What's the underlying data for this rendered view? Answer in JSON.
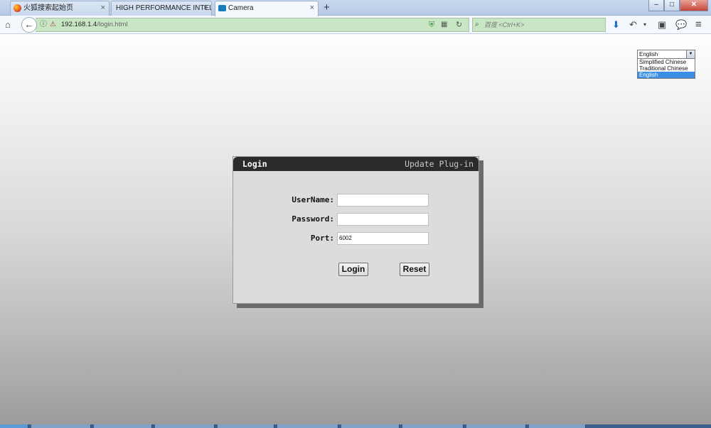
{
  "browser": {
    "tabs": [
      {
        "label": "火狐搜索起始页",
        "active": false,
        "icon": "firefox-icon"
      },
      {
        "label": "HIGH PERFORMANCE INTEL...",
        "active": false,
        "icon": ""
      },
      {
        "label": "Camera",
        "active": true,
        "icon": "camera-icon"
      }
    ],
    "new_tab_label": "+",
    "tab_close_label": "×",
    "address": {
      "host": "192.168.1.4",
      "path": "/login.html"
    },
    "search_placeholder": "百度 <Ctrl+K>",
    "accent": "#c8e6c4"
  },
  "language": {
    "selected": "English",
    "options": [
      "Simplified Chinese",
      "Traditional Chinese",
      "English"
    ]
  },
  "login": {
    "title": "Login",
    "update_link": "Update Plug-in",
    "fields": [
      {
        "label": "UserName:",
        "value": ""
      },
      {
        "label": "Password:",
        "value": ""
      },
      {
        "label": "Port:",
        "value": "6002"
      }
    ],
    "login_button": "Login",
    "reset_button": "Reset"
  }
}
